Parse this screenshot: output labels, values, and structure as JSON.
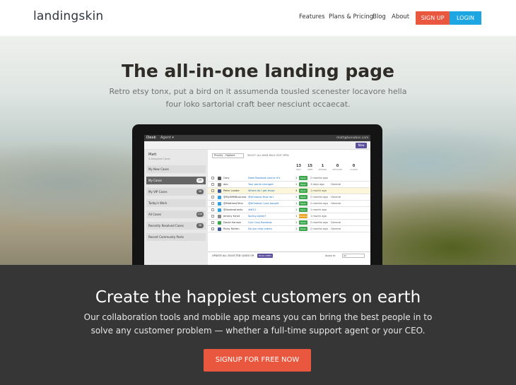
{
  "nav": {
    "brand": "landingskin",
    "links": [
      "Features",
      "Plans & Pricing",
      "Blog",
      "About"
    ],
    "signup_label": "SIGN UP",
    "login_label": "LOGIN",
    "signup_color": "#e9573f",
    "login_color": "#1ea6e3"
  },
  "hero": {
    "title": "The all-in-one landing page",
    "subtitle": "Retro etsy tonx, put a bird on it assumenda tousled scenester locavore hella four loko sartorial craft beer nesciunt occaecat."
  },
  "app": {
    "logo": "Desk",
    "agent": "Agent ▾",
    "user_email": "matt@bonobos.com",
    "new_button": "New",
    "sidebar": {
      "user_name": "Matt",
      "user_sub": "4 Assigned Cases",
      "items": [
        {
          "label": "My New Cases",
          "count": ""
        },
        {
          "label": "My Cases",
          "count": "29"
        },
        {
          "label": "My VIP Cases",
          "count": "08"
        },
        {
          "label": "Today's Work",
          "count": ""
        },
        {
          "label": "All Cases",
          "count": "234"
        },
        {
          "label": "Recently Resolved Cases",
          "count": "08"
        },
        {
          "label": "Recent Community Posts",
          "count": ""
        }
      ]
    },
    "filter": {
      "select": "Priority - Highest",
      "links": "SELECT: ALL NONE   BULK: EDIT OPEN"
    },
    "stats": [
      {
        "value": "13",
        "label": "NEW"
      },
      {
        "value": "15",
        "label": "OPEN"
      },
      {
        "value": "1",
        "label": "PENDING"
      },
      {
        "value": "0",
        "label": "RESOLVED"
      },
      {
        "value": "0",
        "label": "CLOSED"
      }
    ],
    "rows": [
      {
        "name": "Gary",
        "subject": "Does Bonobos source it's",
        "priority": "1",
        "status": "Open",
        "time": "2 months ago",
        "group": ""
      },
      {
        "name": "dan",
        "subject": "Your pants changed",
        "priority": "1",
        "status": "Open",
        "time": "3 days ago",
        "group": "General"
      },
      {
        "name": "Peter Lander",
        "subject": "Where do I get those",
        "priority": "4",
        "status": "Open",
        "time": "1 month ago",
        "group": ""
      },
      {
        "name": "@MySMBBusiness",
        "subject": "@bOnobos How do I",
        "priority": "1",
        "status": "Open",
        "time": "2 months ago",
        "group": "General"
      },
      {
        "name": "@MatthewTriho",
        "subject": "@bOnobos I just bought",
        "priority": "1",
        "status": "Open",
        "time": "2 months ago",
        "group": "General"
      },
      {
        "name": "@landerphants",
        "subject": "#df12",
        "priority": "1",
        "status": "Open",
        "time": "1 month ago",
        "group": ""
      },
      {
        "name": "Jeremy Kmet",
        "subject": "Spring styles?",
        "priority": "1",
        "status": "Pending",
        "time": "1 month ago",
        "group": ""
      },
      {
        "name": "David Hanson",
        "subject": "Can I buy Bonobos",
        "priority": "1",
        "status": "Open",
        "time": "2 months ago",
        "group": "General"
      },
      {
        "name": "Ricky Rutten",
        "subject": "Do you ship orders",
        "priority": "1",
        "status": "Open",
        "time": "2 months ago",
        "group": "General"
      }
    ],
    "bulk": {
      "label": "UPDATE ALL SELECTED CASES OR",
      "button": "BULK OPEN",
      "apply_to": "Apply to",
      "apply_select": "All"
    }
  },
  "cta_section": {
    "title": "Create the happiest customers on earth",
    "subtitle": "Our collaboration tools and mobile app means you can bring the best people in to solve any customer problem — whether a full-time support agent or your CEO.",
    "button": "SIGNUP FOR FREE NOW"
  }
}
